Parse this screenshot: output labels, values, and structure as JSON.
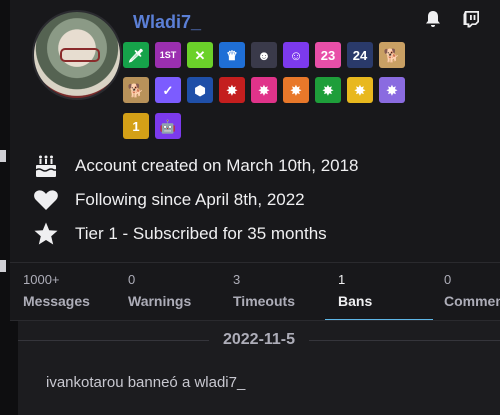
{
  "user": {
    "username": "Wladi7_",
    "avatar_alt": "avatar"
  },
  "header_icons": [
    {
      "name": "notification-bell-icon"
    },
    {
      "name": "twitch-logo-icon"
    }
  ],
  "badges": {
    "row1": [
      {
        "name": "sword-badge",
        "color": "#16a34a",
        "glyph": "🗡"
      },
      {
        "name": "first-place-badge",
        "color": "#9b2fb0",
        "glyph": "1ST"
      },
      {
        "name": "x-badge",
        "color": "#6bd12a",
        "glyph": "✕"
      },
      {
        "name": "crown-badge",
        "color": "#1f6fd6",
        "glyph": "♛"
      },
      {
        "name": "character-badge",
        "color": "#3a3a4a",
        "glyph": "☻"
      },
      {
        "name": "smile-badge",
        "color": "#7c3aed",
        "glyph": "☺"
      },
      {
        "name": "2023-badge",
        "color": "#e84fa8",
        "glyph": "23"
      },
      {
        "name": "2024-badge",
        "color": "#2a3a6a",
        "glyph": "24"
      },
      {
        "name": "dog-badge",
        "color": "#c9a064",
        "glyph": "🐕"
      }
    ],
    "row2": [
      {
        "name": "dog-badge-2",
        "color": "#b8925a",
        "glyph": "🐕"
      },
      {
        "name": "verified-badge",
        "color": "#7c5cff",
        "glyph": "✓"
      },
      {
        "name": "hexagon-badge",
        "color": "#1f4fa8",
        "glyph": "⬢"
      },
      {
        "name": "red-star-badge",
        "color": "#c41e1e",
        "glyph": "✸"
      },
      {
        "name": "pink-star-badge",
        "color": "#e0338a",
        "glyph": "✸"
      },
      {
        "name": "orange-star-badge",
        "color": "#e8782a",
        "glyph": "✸"
      },
      {
        "name": "green-star-badge",
        "color": "#1e9e3a",
        "glyph": "✸"
      },
      {
        "name": "gold-star-badge",
        "color": "#e8b81e",
        "glyph": "✸"
      },
      {
        "name": "purple-star-badge",
        "color": "#8a6be0",
        "glyph": "✸"
      }
    ],
    "row3": [
      {
        "name": "rank-1-badge",
        "color": "#d4a017",
        "glyph": "1"
      },
      {
        "name": "robot-badge",
        "color": "#7c3aed",
        "glyph": "🤖"
      }
    ]
  },
  "info": {
    "account_created": "Account created on March 10th, 2018",
    "following_since": "Following since April 8th, 2022",
    "subscription": "Tier 1 - Subscribed for 35 months"
  },
  "tabs": [
    {
      "count": "1000+",
      "label": "Messages",
      "active": false
    },
    {
      "count": "0",
      "label": "Warnings",
      "active": false
    },
    {
      "count": "3",
      "label": "Timeouts",
      "active": false
    },
    {
      "count": "1",
      "label": "Bans",
      "active": true
    },
    {
      "count": "0",
      "label": "Comments",
      "active": false
    }
  ],
  "log": {
    "date": "2022-11-5",
    "entries": [
      "ivankotarou banneó a wladi7_"
    ]
  },
  "colors": {
    "accent": "#5eb6e6",
    "username": "#5b7fd6",
    "background": "#18181b"
  }
}
